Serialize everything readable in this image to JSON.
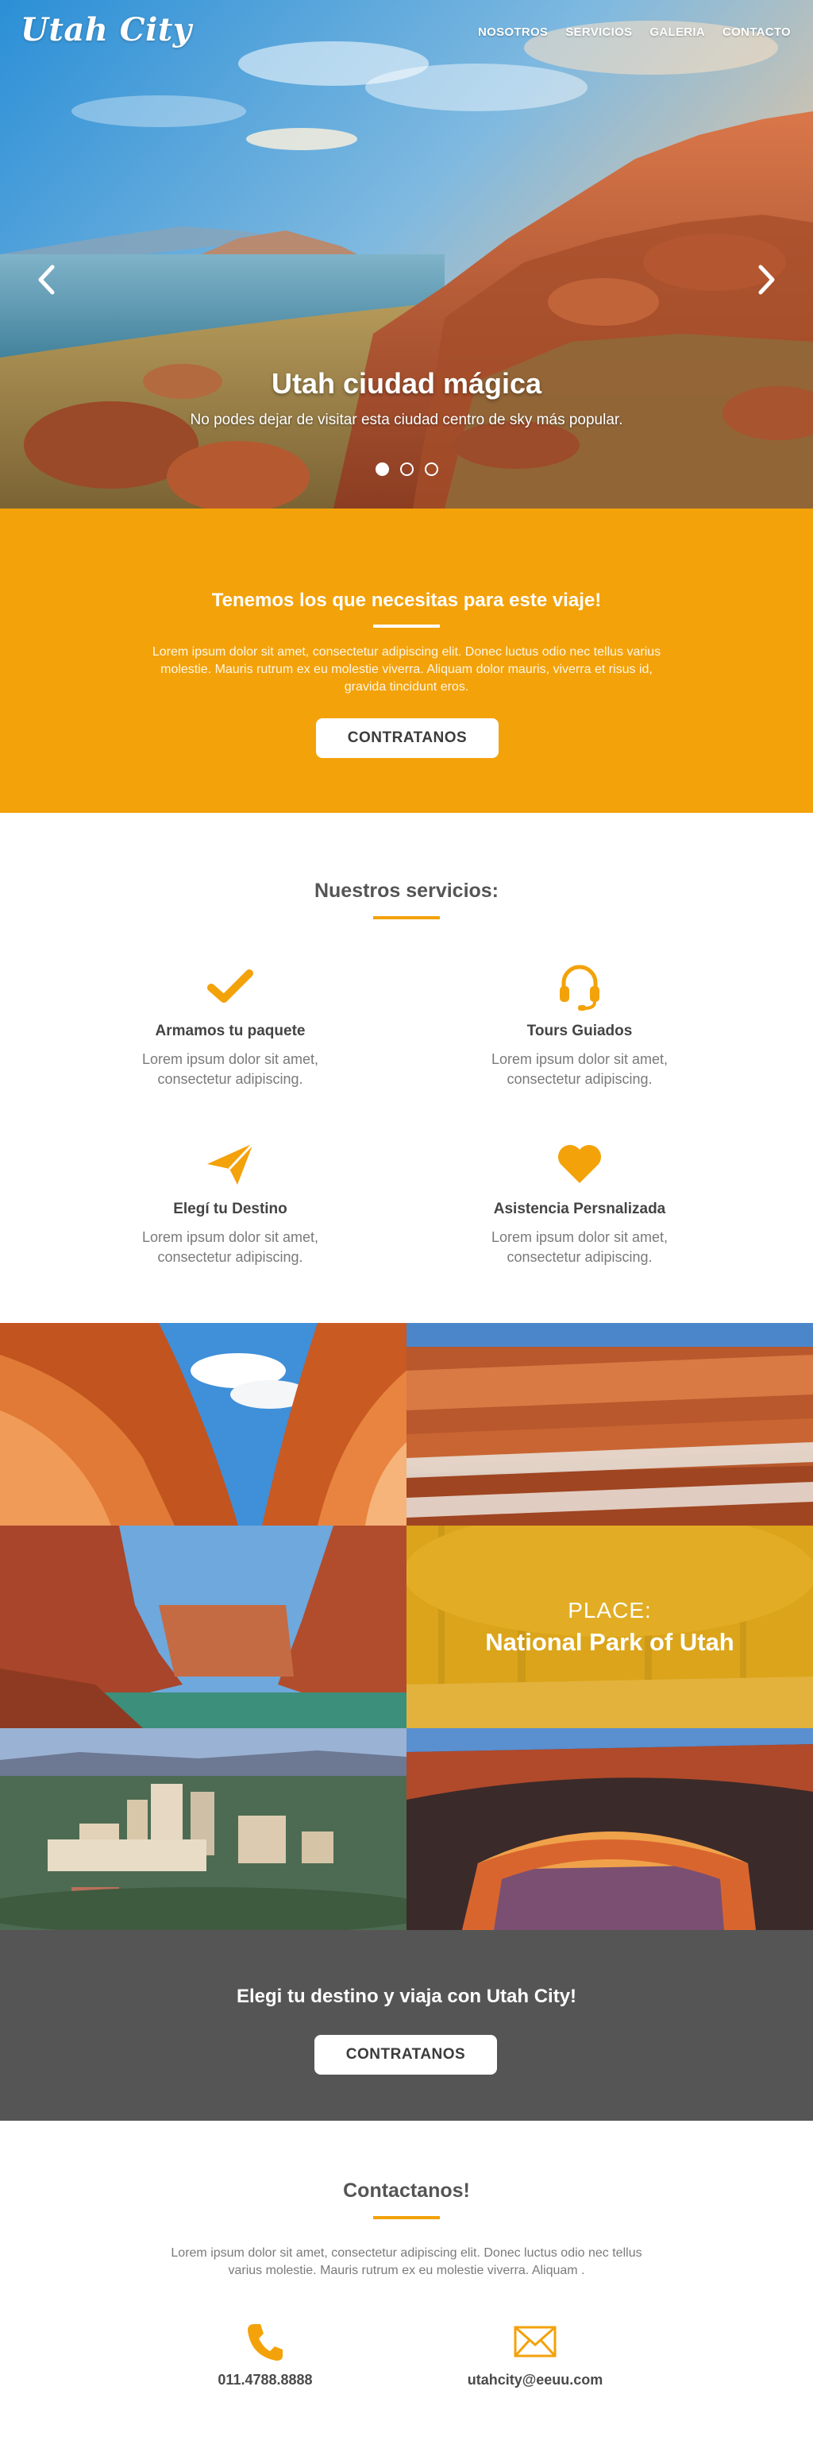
{
  "brand": {
    "logo": "Utah City",
    "accent": "#f3a20a",
    "dark": "#555555"
  },
  "nav": {
    "items": [
      "NOSOTROS",
      "SERVICIOS",
      "GALERIA",
      "CONTACTO"
    ]
  },
  "hero": {
    "title": "Utah ciudad mágica",
    "subtitle": "No podes dejar de visitar esta ciudad centro de sky más popular.",
    "prev_icon": "chevron-left-icon",
    "next_icon": "chevron-right-icon",
    "slides": 3,
    "active_slide": 1
  },
  "banner": {
    "title": "Tenemos los que necesitas para este viaje!",
    "text": "Lorem ipsum dolor sit amet, consectetur adipiscing elit. Donec luctus odio nec tellus varius molestie. Mauris rutrum ex eu molestie viverra. Aliquam dolor mauris, viverra et risus id, gravida tincidunt eros.",
    "button": "CONTRATANOS"
  },
  "services": {
    "title": "Nuestros servicios:",
    "items": [
      {
        "icon": "check-icon",
        "title": "Armamos tu paquete",
        "text": "Lorem ipsum dolor sit amet, consectetur adipiscing."
      },
      {
        "icon": "headset-icon",
        "title": "Tours Guiados",
        "text": "Lorem ipsum dolor sit amet, consectetur adipiscing."
      },
      {
        "icon": "paper-plane-icon",
        "title": "Elegí tu Destino",
        "text": "Lorem ipsum dolor sit amet, consectetur adipiscing."
      },
      {
        "icon": "heart-icon",
        "title": "Asistencia Persnalizada",
        "text": "Lorem ipsum dolor sit amet, consectetur adipiscing."
      }
    ]
  },
  "gallery": {
    "place_label": "PLACE:",
    "place_name": "National Park of Utah"
  },
  "cta": {
    "title": "Elegi tu destino y viaja con Utah City!",
    "button": "CONTRATANOS"
  },
  "contact": {
    "title": "Contactanos!",
    "text": "Lorem ipsum dolor sit amet, consectetur adipiscing elit. Donec luctus odio nec tellus varius molestie. Mauris rutrum ex eu molestie viverra. Aliquam .",
    "phone": "011.4788.8888",
    "email": "utahcity@eeuu.com",
    "phone_icon": "phone-icon",
    "email_icon": "envelope-icon"
  }
}
